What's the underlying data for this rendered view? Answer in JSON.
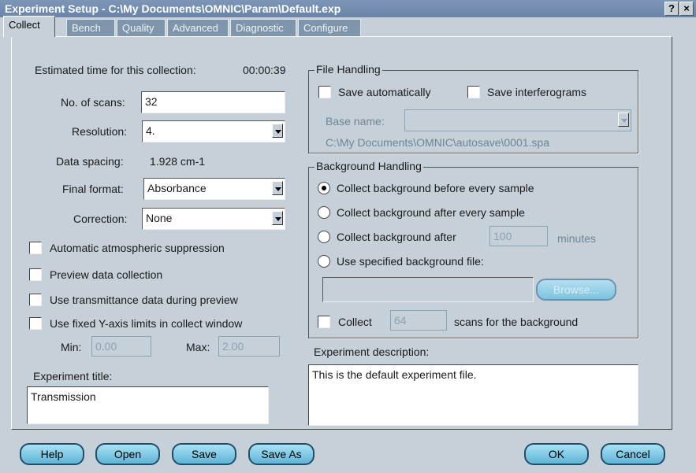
{
  "window": {
    "title": "Experiment Setup - C:\\My Documents\\OMNIC\\Param\\Default.exp",
    "help_btn": "?",
    "close_btn": "×"
  },
  "tabs": [
    "Collect",
    "Bench",
    "Quality",
    "Advanced",
    "Diagnostic",
    "Configure"
  ],
  "collect": {
    "est_time_label": "Estimated time for this collection:",
    "est_time_value": "00:00:39",
    "scans_label": "No. of scans:",
    "scans_value": "32",
    "resolution_label": "Resolution:",
    "resolution_value": "4.",
    "spacing_label": "Data spacing:",
    "spacing_value": "1.928 cm-1",
    "final_format_label": "Final format:",
    "final_format_value": "Absorbance",
    "correction_label": "Correction:",
    "correction_value": "None",
    "checkboxes": [
      "Automatic atmospheric suppression",
      "Preview data collection",
      "Use transmittance data during preview",
      "Use fixed Y-axis limits in collect window"
    ],
    "min_label": "Min:",
    "min_value": "0.00",
    "max_label": "Max:",
    "max_value": "2.00",
    "exp_title_label": "Experiment title:",
    "exp_title_value": "Transmission"
  },
  "file_handling": {
    "title": "File Handling",
    "save_auto": "Save automatically",
    "save_interf": "Save interferograms",
    "base_name_label": "Base name:",
    "path": "C:\\My Documents\\OMNIC\\autosave\\0001.spa"
  },
  "background": {
    "title": "Background Handling",
    "opt1": "Collect background before every sample",
    "opt2": "Collect background after every sample",
    "opt3": "Collect background after",
    "opt3_minutes": "100",
    "opt3_unit": "minutes",
    "opt4": "Use specified background file:",
    "browse": "Browse...",
    "collect_label": "Collect",
    "collect_scans": "64",
    "collect_suffix": "scans for the background"
  },
  "description": {
    "label": "Experiment description:",
    "value": "This is the default experiment file."
  },
  "buttons": {
    "help": "Help",
    "open": "Open",
    "save": "Save",
    "save_as": "Save As",
    "ok": "OK",
    "cancel": "Cancel"
  }
}
